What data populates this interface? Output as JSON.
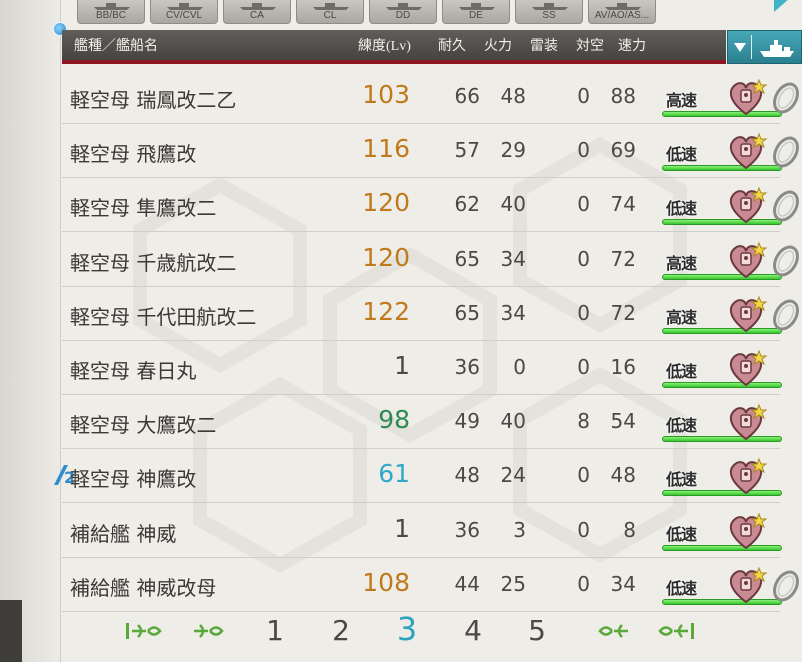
{
  "tabs": [
    {
      "label": "BB/BC",
      "icon": "battleship-silhouette-icon"
    },
    {
      "label": "CV/CVL",
      "icon": "carrier-silhouette-icon"
    },
    {
      "label": "CA",
      "icon": "heavy-cruiser-silhouette-icon"
    },
    {
      "label": "CL",
      "icon": "light-cruiser-silhouette-icon"
    },
    {
      "label": "DD",
      "icon": "destroyer-silhouette-icon"
    },
    {
      "label": "DE",
      "icon": "escort-silhouette-icon"
    },
    {
      "label": "SS",
      "icon": "submarine-silhouette-icon"
    },
    {
      "label": "AV/AO/AS...",
      "icon": "auxiliary-silhouette-icon"
    }
  ],
  "header": {
    "name": "艦種／艦船名",
    "level": "練度(Lv)",
    "hp": "耐久",
    "firepower": "火力",
    "torpedo": "雷装",
    "aa": "対空",
    "speed": "速力"
  },
  "rows": [
    {
      "name": "軽空母 瑞鳳改二乙",
      "lv": "103",
      "lv_color": "#c07a1c",
      "hp": "66",
      "fp": "48",
      "tp": "0",
      "aa": "88",
      "speed": "高速",
      "ring": true,
      "fleet_badge": ""
    },
    {
      "name": "軽空母 飛鷹改",
      "lv": "116",
      "lv_color": "#c07a1c",
      "hp": "57",
      "fp": "29",
      "tp": "0",
      "aa": "69",
      "speed": "低速",
      "ring": true,
      "fleet_badge": ""
    },
    {
      "name": "軽空母 隼鷹改二",
      "lv": "120",
      "lv_color": "#c07a1c",
      "hp": "62",
      "fp": "40",
      "tp": "0",
      "aa": "74",
      "speed": "低速",
      "ring": true,
      "fleet_badge": ""
    },
    {
      "name": "軽空母 千歳航改二",
      "lv": "120",
      "lv_color": "#c07a1c",
      "hp": "65",
      "fp": "34",
      "tp": "0",
      "aa": "72",
      "speed": "高速",
      "ring": true,
      "fleet_badge": ""
    },
    {
      "name": "軽空母 千代田航改二",
      "lv": "122",
      "lv_color": "#c07a1c",
      "hp": "65",
      "fp": "34",
      "tp": "0",
      "aa": "72",
      "speed": "高速",
      "ring": true,
      "fleet_badge": ""
    },
    {
      "name": "軽空母 春日丸",
      "lv": "1",
      "lv_color": "#4a4945",
      "hp": "36",
      "fp": "0",
      "tp": "0",
      "aa": "16",
      "speed": "低速",
      "ring": false,
      "fleet_badge": ""
    },
    {
      "name": "軽空母 大鷹改二",
      "lv": "98",
      "lv_color": "#2e8a52",
      "hp": "49",
      "fp": "40",
      "tp": "8",
      "aa": "54",
      "speed": "低速",
      "ring": false,
      "fleet_badge": ""
    },
    {
      "name": "軽空母 神鷹改",
      "lv": "61",
      "lv_color": "#2ea8c8",
      "hp": "48",
      "fp": "24",
      "tp": "0",
      "aa": "48",
      "speed": "低速",
      "ring": false,
      "fleet_badge": "2"
    },
    {
      "name": "補給艦 神威",
      "lv": "1",
      "lv_color": "#4a4945",
      "hp": "36",
      "fp": "3",
      "tp": "0",
      "aa": "8",
      "speed": "低速",
      "ring": false,
      "fleet_badge": ""
    },
    {
      "name": "補給艦 神威改母",
      "lv": "108",
      "lv_color": "#c07a1c",
      "hp": "44",
      "fp": "25",
      "tp": "0",
      "aa": "34",
      "speed": "低速",
      "ring": true,
      "fleet_badge": ""
    }
  ],
  "pager": {
    "pages": [
      "1",
      "2",
      "3",
      "4",
      "5"
    ],
    "current": "3",
    "first_icon": "first-page-icon",
    "prev_icon": "prev-page-icon",
    "next_icon": "next-page-icon",
    "last_icon": "last-page-icon"
  },
  "colors": {
    "accent_teal": "#3aa6b8",
    "header_red": "#8e1822",
    "level_orange": "#c07a1c",
    "level_green": "#2e8a52",
    "level_blue": "#2ea8c8",
    "hp_green": "#35c62c"
  }
}
